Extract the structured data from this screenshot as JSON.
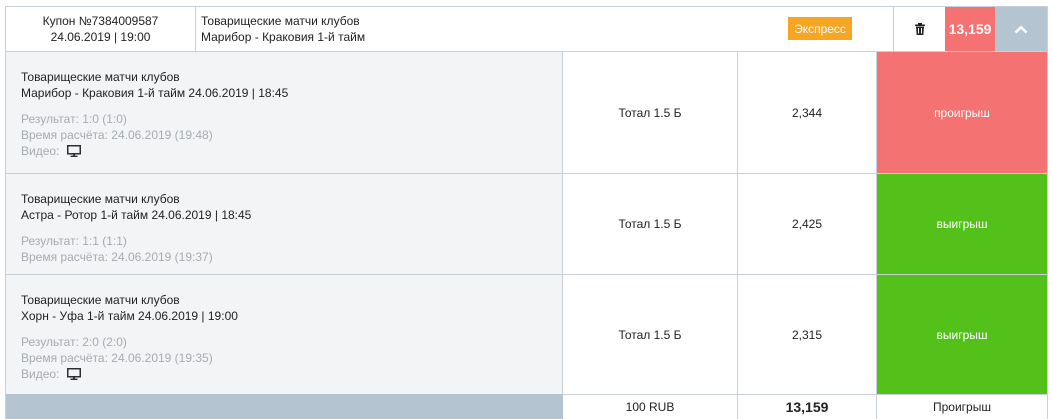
{
  "header": {
    "coupon_label": "Купон №7384009587",
    "coupon_datetime": "24.06.2019 | 19:00",
    "league": "Товарищеские матчи клубов",
    "match": "Марибор - Краковия 1-й тайм",
    "type_badge": "Экспресс",
    "total_odds": "13,159",
    "delete_icon": "trash-icon",
    "toggle_icon": "chevron-up-icon"
  },
  "bets": [
    {
      "league": "Товарищеские матчи клубов",
      "event": "Марибор - Краковия 1-й тайм 24.06.2019 | 18:45",
      "result": "Результат: 1:0 (1:0)",
      "settled": "Время расчёта: 24.06.2019 (19:48)",
      "video_label": "Видео:",
      "market": "Тотал 1.5 Б",
      "odds": "2,344",
      "status": "проигрыш"
    },
    {
      "league": "Товарищеские матчи клубов",
      "event": "Астра - Ротор 1-й тайм 24.06.2019 | 18:45",
      "result": "Результат: 1:1 (1:1)",
      "settled": "Время расчёта: 24.06.2019 (19:37)",
      "market": "Тотал 1.5 Б",
      "odds": "2,425",
      "status": "выигрыш"
    },
    {
      "league": "Товарищеские матчи клубов",
      "event": "Хорн - Уфа 1-й тайм 24.06.2019 | 19:00",
      "result": "Результат: 2:0 (2:0)",
      "settled": "Время расчёта: 24.06.2019 (19:35)",
      "video_label": "Видео:",
      "market": "Тотал 1.5 Б",
      "odds": "2,315",
      "status": "выигрыш"
    }
  ],
  "footer": {
    "stake": "100 RUB",
    "total_odds": "13,159",
    "outcome": "Проигрыш"
  },
  "colors": {
    "lose": "#f47372",
    "win": "#53c11a",
    "badge": "#f6a623",
    "accent": "#b5c4d1"
  }
}
